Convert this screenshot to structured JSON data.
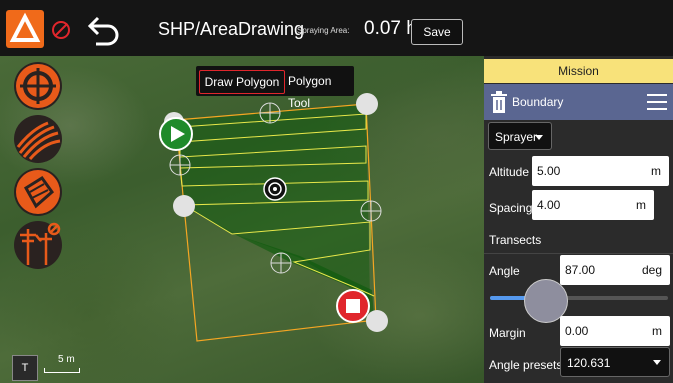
{
  "header": {
    "title": "SHP/AreaDrawing",
    "area_label": "Spraying Area:",
    "area_value": "0.07 ha",
    "save_label": "Save"
  },
  "map": {
    "tabs": {
      "active": "Draw Polygon",
      "other": "Polygon Tool"
    },
    "scale_toggle": "T",
    "scale_text": "5 m",
    "tools": [
      "target-icon",
      "field-rows-icon",
      "polygon-icon",
      "powerline-icon"
    ]
  },
  "panel": {
    "mission": "Mission",
    "boundary": "Boundary",
    "sprayer": "Sprayer",
    "altitude_label": "Altitude",
    "altitude_value": "5.00",
    "altitude_unit": "m",
    "spacing_label": "Spacing",
    "spacing_value": "4.00",
    "spacing_unit": "m",
    "transects": "Transects",
    "angle_label": "Angle",
    "angle_value": "87.00",
    "angle_unit": "deg",
    "margin_label": "Margin",
    "margin_value": "0.00",
    "margin_unit": "m",
    "presets_label": "Angle presets",
    "presets_value": "120.631"
  },
  "colors": {
    "accent": "#f06a1a",
    "stop": "#e0262c",
    "polygon": "#f5a623",
    "transect": "#e8e84a",
    "mission": "#f8e27a",
    "boundary": "#5a6691"
  }
}
